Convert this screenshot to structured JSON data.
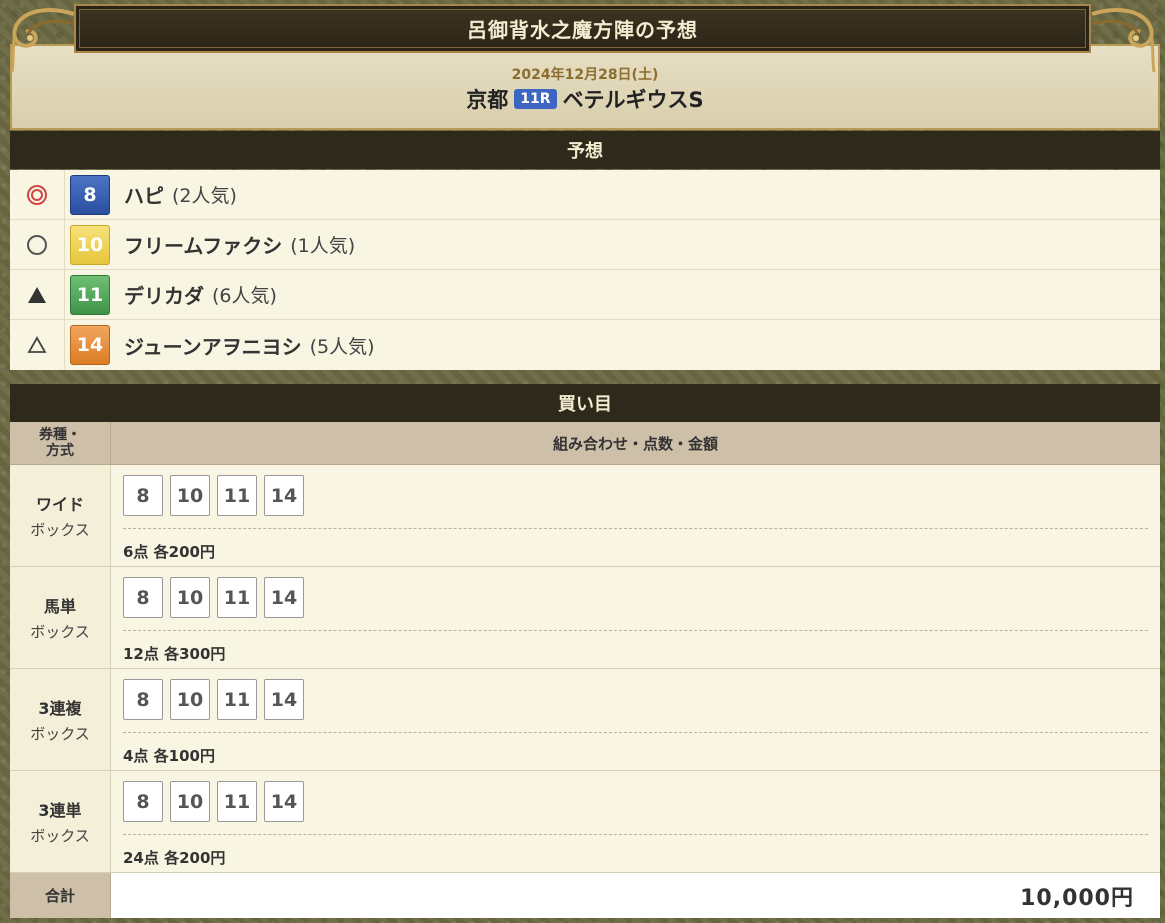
{
  "header": {
    "title": "呂御背水之魔方陣の予想",
    "date": "2024年12月28日(土)",
    "venue": "京都",
    "race_no": "11R",
    "race_name": "ベテルギウスS"
  },
  "prediction": {
    "heading": "予想",
    "rows": [
      {
        "mark": "◎",
        "number": "8",
        "color": "#2a4f9f",
        "name": "ハピ",
        "popularity": "(2人気)"
      },
      {
        "mark": "○",
        "number": "10",
        "color": "#e6c63c",
        "name": "フリームファクシ",
        "popularity": "(1人気)"
      },
      {
        "mark": "▲",
        "number": "11",
        "color": "#3f9347",
        "name": "デリカダ",
        "popularity": "(6人気)"
      },
      {
        "mark": "△",
        "number": "14",
        "color": "#db7d26",
        "name": "ジューンアヲニヨシ",
        "popularity": "(5人気)"
      }
    ]
  },
  "bets": {
    "heading": "買い目",
    "col_type": "券種・方式",
    "col_type_line1": "券種・",
    "col_type_line2": "方式",
    "col_detail": "組み合わせ・点数・金額",
    "rows": [
      {
        "type": "ワイド",
        "method": "ボックス",
        "numbers": [
          "8",
          "10",
          "11",
          "14"
        ],
        "info": "6点 各200円"
      },
      {
        "type": "馬単",
        "method": "ボックス",
        "numbers": [
          "8",
          "10",
          "11",
          "14"
        ],
        "info": "12点 各300円"
      },
      {
        "type": "3連複",
        "method": "ボックス",
        "numbers": [
          "8",
          "10",
          "11",
          "14"
        ],
        "info": "4点 各100円"
      },
      {
        "type": "3連単",
        "method": "ボックス",
        "numbers": [
          "8",
          "10",
          "11",
          "14"
        ],
        "info": "24点 各200円"
      }
    ],
    "total_label": "合計",
    "total_value": "10,000円"
  }
}
